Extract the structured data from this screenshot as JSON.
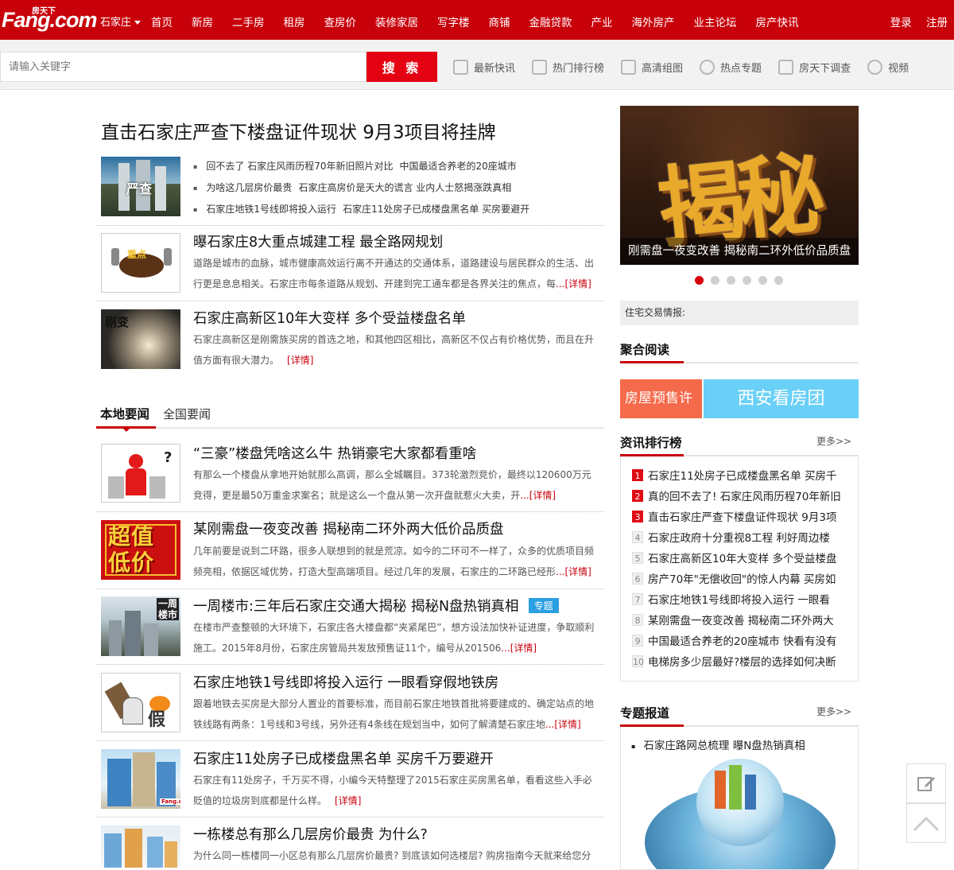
{
  "header": {
    "logo_text": "Fang.com",
    "logo_small": "房天下",
    "city": "石家庄",
    "nav": [
      "首页",
      "新房",
      "二手房",
      "租房",
      "查房价",
      "装修家居",
      "写字楼",
      "商铺",
      "金融贷款",
      "产业",
      "海外房产",
      "业主论坛",
      "房产快讯"
    ],
    "login": "登录",
    "register": "注册"
  },
  "search": {
    "placeholder": "请输入关键字",
    "button": "搜 索",
    "quick_links": [
      {
        "label": "最新快讯",
        "icon": "news-list-icon"
      },
      {
        "label": "热门排行榜",
        "icon": "ranking-icon"
      },
      {
        "label": "高清组图",
        "icon": "image-icon"
      },
      {
        "label": "热点专题",
        "icon": "flame-icon"
      },
      {
        "label": "房天下调查",
        "icon": "survey-edit-icon"
      },
      {
        "label": "视频",
        "icon": "play-icon"
      }
    ]
  },
  "main": {
    "headline": "直击石家庄严查下楼盘证件现状 9月3项目将挂牌",
    "lead": {
      "thumb_label": "严查",
      "bullets": [
        [
          "回不去了 石家庄风雨历程70年新旧照片对比",
          "中国最适合养老的20座城市"
        ],
        [
          "为啥这几层房价最贵",
          "石家庄高房价是天大的谎言 业内人士怒揭涨跌真相"
        ],
        [
          "石家庄地铁1号线即将投入运行",
          "石家庄11处房子已成楼盘黑名单 买房要避开"
        ]
      ]
    },
    "features": [
      {
        "thumb_label": "重点",
        "title": "曝石家庄8大重点城建工程 最全路网规划",
        "desc": "道路是城市的血脉，城市健康高效运行离不开通达的交通体系，道路建设与居民群众的生活、出行更是息息相关。石家庄市每条道路从规划、开建到完工通车都是各界关注的焦点，每",
        "more": "...[详情]"
      },
      {
        "thumb_label": "剧变",
        "title": "石家庄高新区10年大变样 多个受益楼盘名单",
        "desc": "石家庄高新区是刚需族买房的首选之地，和其他四区相比，高新区不仅占有价格优势，而且在升值方面有很大潜力。",
        "more": "[详情]"
      }
    ],
    "tabs": [
      "本地要闻",
      "全国要闻"
    ],
    "news": [
      {
        "title": "“三豪”楼盘凭啥这么牛 热销豪宅大家都看重啥",
        "desc": "有那么一个楼盘从拿地开始就那么高调，那么全城瞩目。373轮激烈竞价，最终以120600万元竞得，更是最50万重金求案名；就是这么一个盘从第一次开盘就惹火大卖，开",
        "more": "...[详情]",
        "tag": ""
      },
      {
        "title": "某刚需盘一夜变改善 揭秘南二环外两大低价品质盘",
        "desc": "几年前要是说到二环路，很多人联想到的就是荒凉。如今的二环可不一样了，众多的优质项目频频亮相，依据区域优势，打造大型高端项目。经过几年的发展，石家庄的二环路已经形",
        "more": "...[详情]",
        "tag": "",
        "thumb_label": "超值低价"
      },
      {
        "title": "一周楼市:三年后石家庄交通大揭秘 揭秘N盘热销真相",
        "desc": "在楼市严查整顿的大环境下，石家庄各大楼盘都“夹紧尾巴”，想方设法加快补证进度，争取顺利施工。2015年8月份，石家庄房管局共发放预售证11个，编号从201506",
        "more": "...[详情]",
        "tag": "专题",
        "thumb_label": "一周楼市"
      },
      {
        "title": "石家庄地铁1号线即将投入运行 一眼看穿假地铁房",
        "desc": "跟着地铁去买房是大部分人置业的首要标准，而目前石家庄地铁首批将要建成的、确定站点的地铁线路有两条：1号线和3号线，另外还有4条线在规划当中，如何了解清楚石家庄地",
        "more": "...[详情]",
        "tag": "",
        "thumb_label": "假"
      },
      {
        "title": "石家庄11处房子已成楼盘黑名单 买房千万要避开",
        "desc": "石家庄有11处房子，千万买不得，小编今天特整理了2015石家庄买房黑名单，看看这些入手必贬值的垃圾房到底都是什么样。",
        "more": "[详情]",
        "tag": "",
        "thumb_label": "Fang.com"
      },
      {
        "title": "一栋楼总有那么几层房价最贵 为什么?",
        "desc": "为什么同一栋楼同一小区总有那么几层房价最贵? 到底该如何选楼层? 购房指南今天就来给您分",
        "more": "",
        "tag": ""
      }
    ]
  },
  "sidebar": {
    "banner_text": "揭秘",
    "banner_caption": "刚需盘一夜变改善 揭秘南二环外低价品质盘",
    "slides": 6,
    "ticker": "住宅交易情报:",
    "aggregate_title": "聚合阅读",
    "presale": "房屋预售许",
    "tour": "西安看房团",
    "ranking_title": "资讯排行榜",
    "more": "更多>>",
    "ranking": [
      "石家庄11处房子已成楼盘黑名单 买房千",
      "真的回不去了! 石家庄风雨历程70年新旧",
      "直击石家庄严查下楼盘证件现状 9月3项",
      "石家庄政府十分重视8工程 利好周边楼",
      "石家庄高新区10年大变样 多个受益楼盘",
      "房产70年\"无偿收回\"的惊人内幕 买房如",
      "石家庄地铁1号线即将投入运行 一眼看",
      "某刚需盘一夜变改善 揭秘南二环外两大",
      "中国最适合养老的20座城市 快看有没有",
      "电梯房多少层最好?楼层的选择如何决断"
    ],
    "topics_title": "专题报道",
    "topics": [
      "石家庄路网总梳理 曝N盘热销真相"
    ]
  },
  "colors": {
    "brand_red": "#c8000a",
    "search_red": "#e40212",
    "tag_blue": "#2a9fe1",
    "presale_orange": "#f46a4b",
    "tour_blue": "#6ad0f7"
  },
  "floating": {
    "feedback_icon": "edit-icon",
    "top_icon": "chevron-up-icon"
  }
}
